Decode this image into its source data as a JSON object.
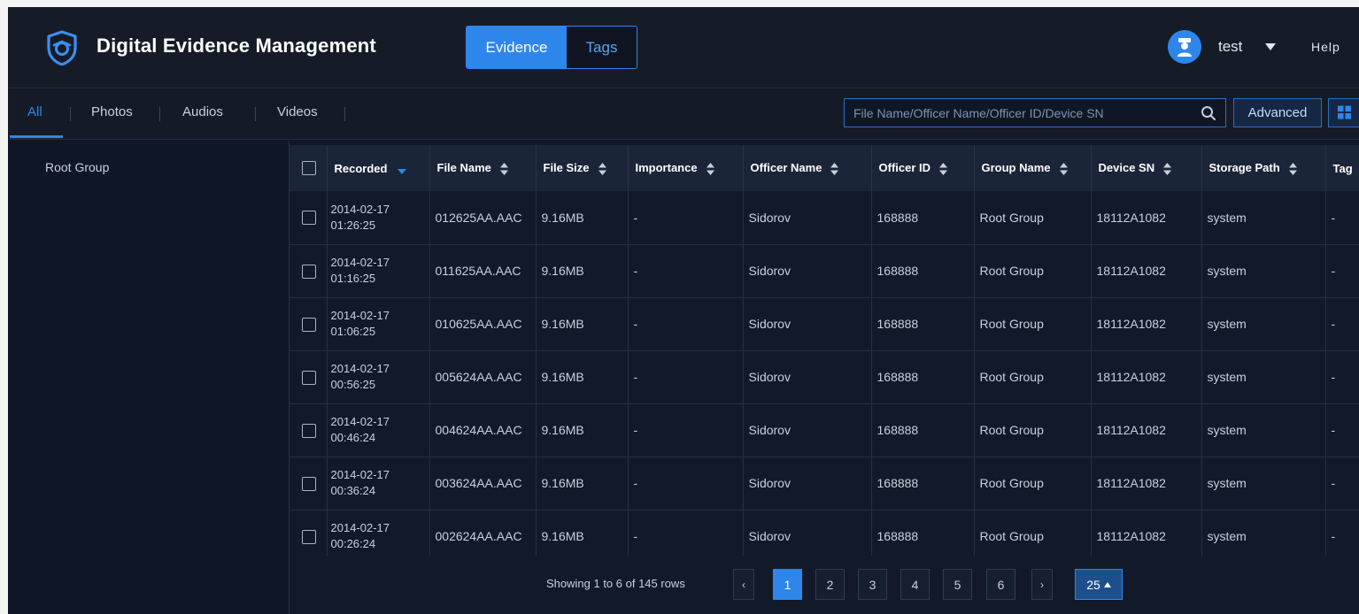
{
  "header": {
    "title": "Digital Evidence Management",
    "mode_tabs": [
      {
        "label": "Evidence",
        "active": true
      },
      {
        "label": "Tags",
        "active": false
      }
    ],
    "username": "test",
    "help_label": "Help",
    "accent_color": "#2f86ea"
  },
  "filters": {
    "tabs": [
      {
        "label": "All",
        "active": true
      },
      {
        "label": "Photos",
        "active": false
      },
      {
        "label": "Audios",
        "active": false
      },
      {
        "label": "Videos",
        "active": false
      }
    ],
    "search_placeholder": "File Name/Officer Name/Officer ID/Device SN",
    "advanced_label": "Advanced"
  },
  "sidebar": {
    "items": [
      {
        "label": "Root Group"
      }
    ]
  },
  "table": {
    "columns": [
      "Recorded",
      "File Name",
      "File Size",
      "Importance",
      "Officer Name",
      "Officer ID",
      "Group Name",
      "Device SN",
      "Storage Path",
      "Tag"
    ],
    "rows": [
      {
        "recorded": "2014-02-17 01:26:25",
        "file_name": "012625AA.AAC",
        "file_size": "9.16MB",
        "importance": "-",
        "officer_name": "Sidorov",
        "officer_id": "168888",
        "group_name": "Root Group",
        "device_sn": "18112A1082",
        "storage_path": "system",
        "tag": "-"
      },
      {
        "recorded": "2014-02-17 01:16:25",
        "file_name": "011625AA.AAC",
        "file_size": "9.16MB",
        "importance": "-",
        "officer_name": "Sidorov",
        "officer_id": "168888",
        "group_name": "Root Group",
        "device_sn": "18112A1082",
        "storage_path": "system",
        "tag": "-"
      },
      {
        "recorded": "2014-02-17 01:06:25",
        "file_name": "010625AA.AAC",
        "file_size": "9.16MB",
        "importance": "-",
        "officer_name": "Sidorov",
        "officer_id": "168888",
        "group_name": "Root Group",
        "device_sn": "18112A1082",
        "storage_path": "system",
        "tag": "-"
      },
      {
        "recorded": "2014-02-17 00:56:25",
        "file_name": "005624AA.AAC",
        "file_size": "9.16MB",
        "importance": "-",
        "officer_name": "Sidorov",
        "officer_id": "168888",
        "group_name": "Root Group",
        "device_sn": "18112A1082",
        "storage_path": "system",
        "tag": "-"
      },
      {
        "recorded": "2014-02-17 00:46:24",
        "file_name": "004624AA.AAC",
        "file_size": "9.16MB",
        "importance": "-",
        "officer_name": "Sidorov",
        "officer_id": "168888",
        "group_name": "Root Group",
        "device_sn": "18112A1082",
        "storage_path": "system",
        "tag": "-"
      },
      {
        "recorded": "2014-02-17 00:36:24",
        "file_name": "003624AA.AAC",
        "file_size": "9.16MB",
        "importance": "-",
        "officer_name": "Sidorov",
        "officer_id": "168888",
        "group_name": "Root Group",
        "device_sn": "18112A1082",
        "storage_path": "system",
        "tag": "-"
      },
      {
        "recorded": "2014-02-17 00:26:24",
        "file_name": "002624AA.AAC",
        "file_size": "9.16MB",
        "importance": "-",
        "officer_name": "Sidorov",
        "officer_id": "168888",
        "group_name": "Root Group",
        "device_sn": "18112A1082",
        "storage_path": "system",
        "tag": "-"
      }
    ]
  },
  "pagination": {
    "info": "Showing 1 to 6 of 145 rows",
    "prev_label": "‹",
    "next_label": "›",
    "pages": [
      "1",
      "2",
      "3",
      "4",
      "5",
      "6"
    ],
    "current_page": "1",
    "page_size": "25"
  }
}
